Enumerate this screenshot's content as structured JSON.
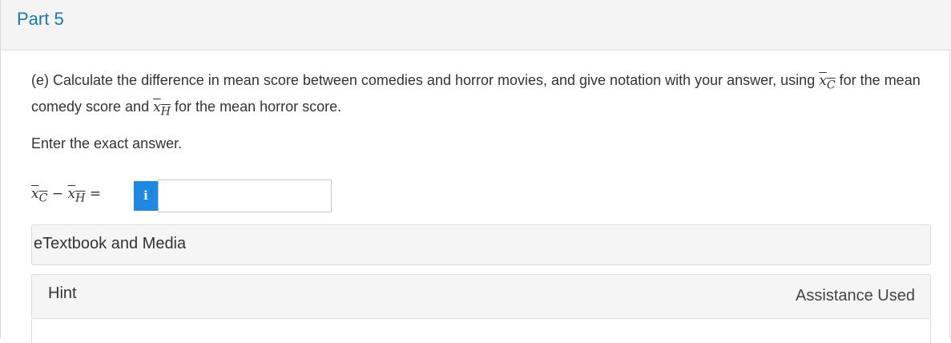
{
  "part": {
    "title": "Part 5"
  },
  "question": {
    "text_before": "(e) Calculate the difference in mean score between comedies and horror movies, and give notation with your answer, using ",
    "var_c_base": "x",
    "var_c_sub": "C",
    "text_middle": " for the mean comedy score and ",
    "var_h_base": "x",
    "var_h_sub": "H",
    "text_after": " for the mean horror score."
  },
  "instructions": "Enter the exact answer.",
  "equation": {
    "left_base": "x",
    "left_sub": "C",
    "minus": "−",
    "right_base": "x",
    "right_sub": "H",
    "equals": "="
  },
  "answer": {
    "info_icon": "i",
    "value": ""
  },
  "etextbook": {
    "label": "eTextbook and Media"
  },
  "hint": {
    "label": "Hint",
    "status": "Assistance Used"
  },
  "colors": {
    "accent": "#1b75bc",
    "info_button": "#1e88e5"
  }
}
